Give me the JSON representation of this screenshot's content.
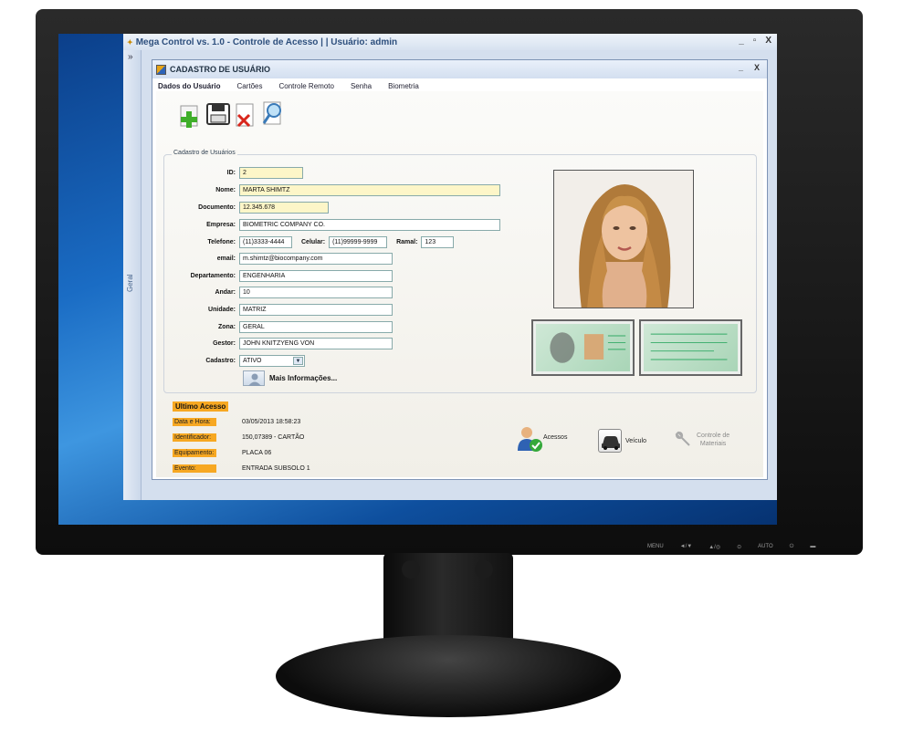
{
  "app": {
    "title": "Mega Control vs. 1.0 - Controle de Acesso | | Usuário: admin",
    "window_controls": [
      "_",
      "▫",
      "X"
    ],
    "sidebar_toggle": "»",
    "sidebar_tab": "Geral"
  },
  "child_window": {
    "title": "CADASTRO DE USUÁRIO",
    "window_controls": [
      "_",
      "X"
    ]
  },
  "tabs": [
    {
      "label": "Dados do Usuário",
      "active": true
    },
    {
      "label": "Cartões",
      "active": false
    },
    {
      "label": "Controle Remoto",
      "active": false
    },
    {
      "label": "Senha",
      "active": false
    },
    {
      "label": "Biometria",
      "active": false
    }
  ],
  "toolbar": {
    "icons": [
      "add-icon",
      "save-icon",
      "delete-icon",
      "search-icon"
    ]
  },
  "form": {
    "legend": "Cadastro de Usuários",
    "id_label": "ID:",
    "id_value": "2",
    "nome_label": "Nome:",
    "nome_value": "MARTA SHIMTZ",
    "documento_label": "Documento:",
    "documento_value": "12.345.678",
    "empresa_label": "Empresa:",
    "empresa_value": "BIOMETRIC COMPANY CO.",
    "telefone_label": "Telefone:",
    "telefone_value": "(11)3333-4444",
    "celular_label": "Celular:",
    "celular_value": "(11)99999-9999",
    "ramal_label": "Ramal:",
    "ramal_value": "123",
    "email_label": "email:",
    "email_value": "m.shimtz@biocompany.com",
    "departamento_label": "Departamento:",
    "departamento_value": "ENGENHARIA",
    "andar_label": "Andar:",
    "andar_value": "10",
    "unidade_label": "Unidade:",
    "unidade_value": "MATRIZ",
    "zona_label": "Zona:",
    "zona_value": "GERAL",
    "gestor_label": "Gestor:",
    "gestor_value": "JOHN KNITZYENG VON",
    "cadastro_label": "Cadastro:",
    "cadastro_value": "ATIVO",
    "more_info": "Mais Informações..."
  },
  "access": {
    "title": "Ultimo Acesso",
    "rows": [
      {
        "label": "Data e Hora:",
        "value": "03/05/2013 18:58:23"
      },
      {
        "label": "Identificador:",
        "value": "150,07389 - CARTÃO"
      },
      {
        "label": "Equipamento:",
        "value": "PLACA 06"
      },
      {
        "label": "Evento:",
        "value": "ENTRADA SUBSOLO 1"
      }
    ]
  },
  "actions": {
    "acessos": "Acessos",
    "veiculo": "Veículo",
    "materiais_line1": "Controle de",
    "materiais_line2": "Materiais"
  },
  "monitor": {
    "controls": [
      "MENU",
      "◄/▼",
      "▲/◎",
      "⊙",
      "AUTO",
      "⏻",
      "▬"
    ]
  },
  "colors": {
    "accent": "#f7a822",
    "title_text": "#2d4f7d",
    "highlight_field": "#fdf6c8"
  }
}
